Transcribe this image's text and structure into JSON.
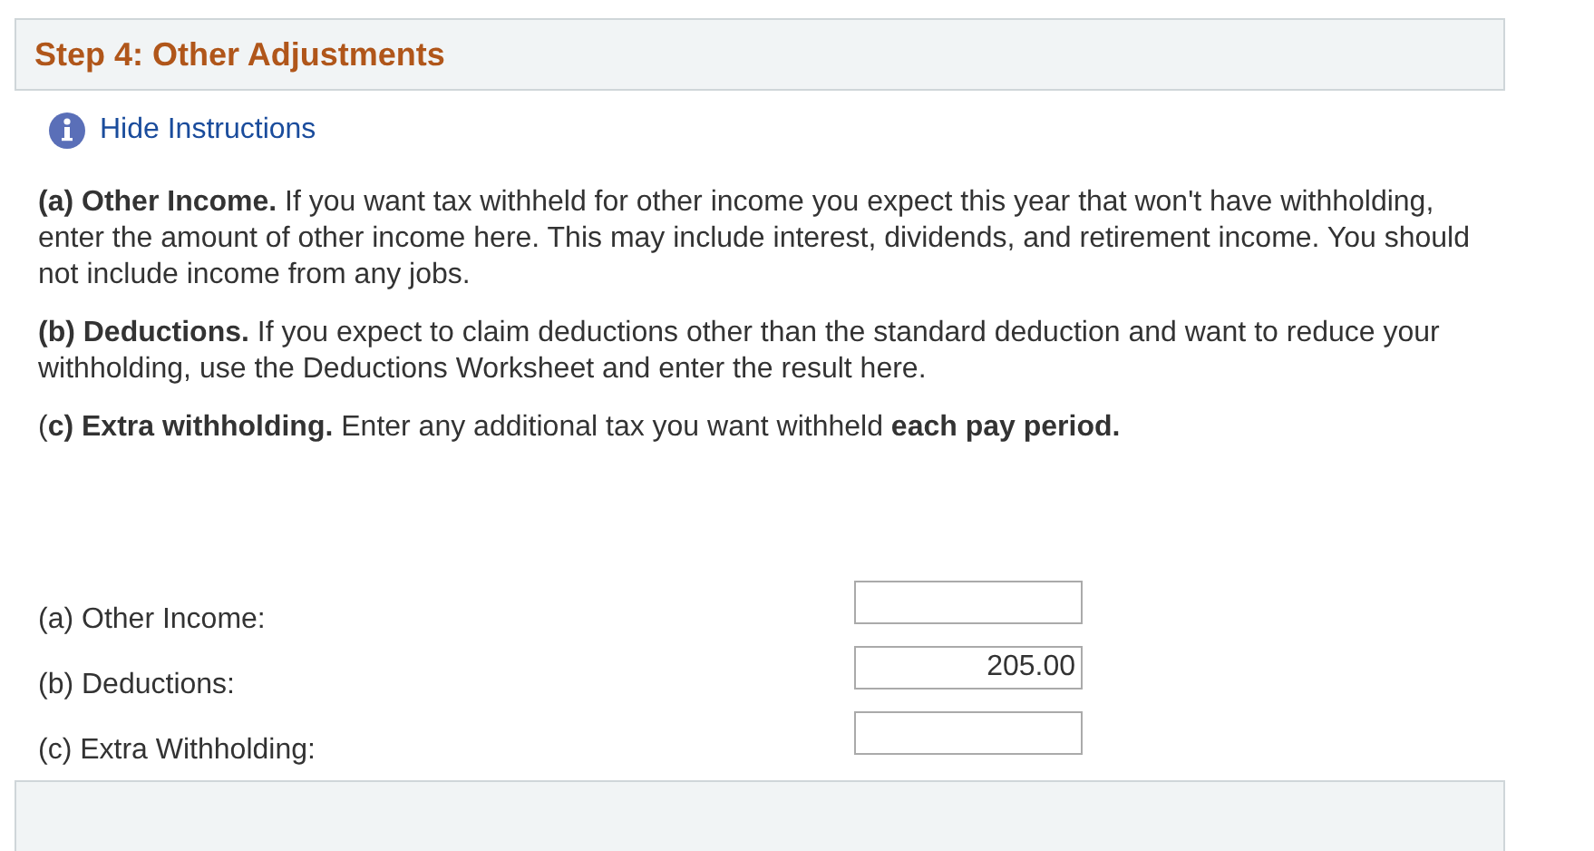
{
  "section": {
    "title": "Step 4: Other Adjustments"
  },
  "instructions_link": "Hide Instructions",
  "paragraphs": [
    "**(a) Other Income.** If you want tax withheld for other income you expect this year that won't have withholding, enter the amount of other income here. This may include interest, dividends, and retirement income. You should not include income from any jobs.",
    "**(b) Deductions.** If you expect to claim deductions other than the standard deduction and want to reduce your withholding, use the Deductions Worksheet and enter the result here.",
    "(**c) Extra withholding.** Enter any additional tax you want withheld **each pay period.**"
  ],
  "fields": [
    {
      "label": "(a) Other Income:"
    },
    {
      "label": "(b) Deductions:",
      "value": "205.00"
    },
    {
      "label": "(c) Extra Withholding:"
    }
  ],
  "next_section": {
    "kind": "collapsed-header"
  }
}
